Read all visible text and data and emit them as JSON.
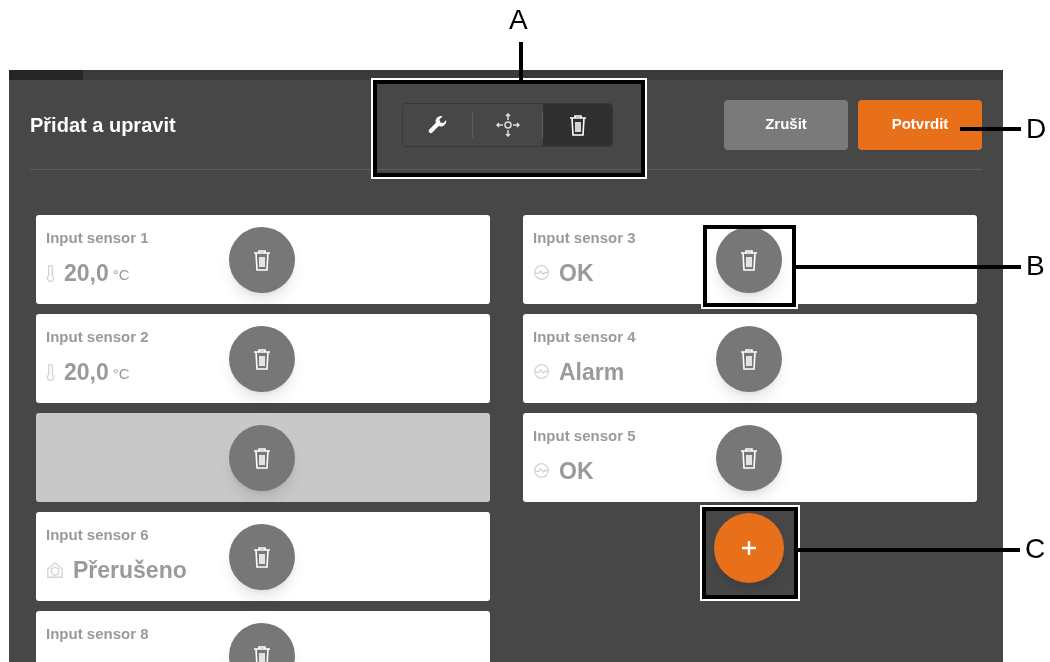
{
  "header": {
    "title": "Přidat a upravit"
  },
  "tools": [
    {
      "kind": "wrench",
      "selected": false
    },
    {
      "kind": "move",
      "selected": false
    },
    {
      "kind": "delete",
      "selected": true
    }
  ],
  "buttons": [
    {
      "kind": "cancel",
      "label": "Zrušit"
    },
    {
      "kind": "confirm",
      "label": "Potvrdit"
    }
  ],
  "columns": [
    {
      "tiles": [
        {
          "kind": "temperature",
          "name": "Input sensor 1",
          "value": "20,0",
          "unit": "°C"
        },
        {
          "kind": "temperature",
          "name": "Input sensor 2",
          "value": "20,0",
          "unit": "°C"
        },
        {
          "kind": "empty"
        },
        {
          "kind": "door",
          "name": "Input sensor 6",
          "value": "Přerušeno"
        },
        {
          "kind": "none",
          "name": "Input sensor 8"
        }
      ],
      "add_button": false
    },
    {
      "tiles": [
        {
          "kind": "status",
          "name": "Input sensor 3",
          "value": "OK"
        },
        {
          "kind": "status",
          "name": "Input sensor 4",
          "value": "Alarm"
        },
        {
          "kind": "status",
          "name": "Input sensor 5",
          "value": "OK"
        }
      ],
      "add_button": true
    }
  ],
  "callouts": [
    {
      "letter": "A"
    },
    {
      "letter": "D"
    },
    {
      "letter": "B"
    },
    {
      "letter": "C"
    }
  ]
}
